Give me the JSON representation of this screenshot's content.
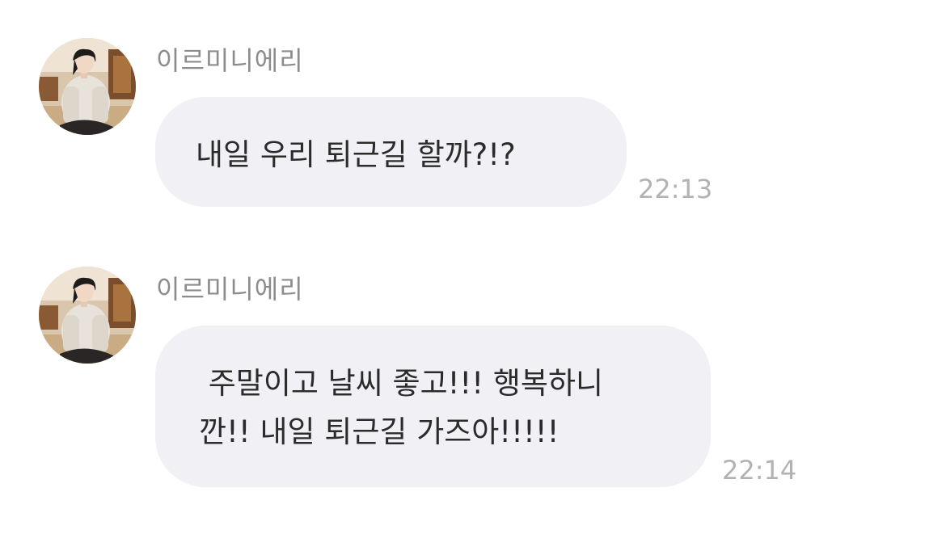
{
  "messages": [
    {
      "sender": "이르미니에리",
      "avatar_icon": "profile-photo-avatar",
      "lines": [
        "내일 우리 퇴근길 할까?!?"
      ],
      "time": "22:13"
    },
    {
      "sender": "이르미니에리",
      "avatar_icon": "profile-photo-avatar",
      "lines": [
        " 주말이고 날씨 좋고!!! 행복하니",
        "깐!! 내일 퇴근길 가즈아!!!!!"
      ],
      "time": "22:14"
    }
  ],
  "colors": {
    "bubble": "#f0f0f5",
    "text": "#2b2b2b",
    "sender": "#8c8c8c",
    "time": "#b2b2b2",
    "background": "#ffffff"
  }
}
